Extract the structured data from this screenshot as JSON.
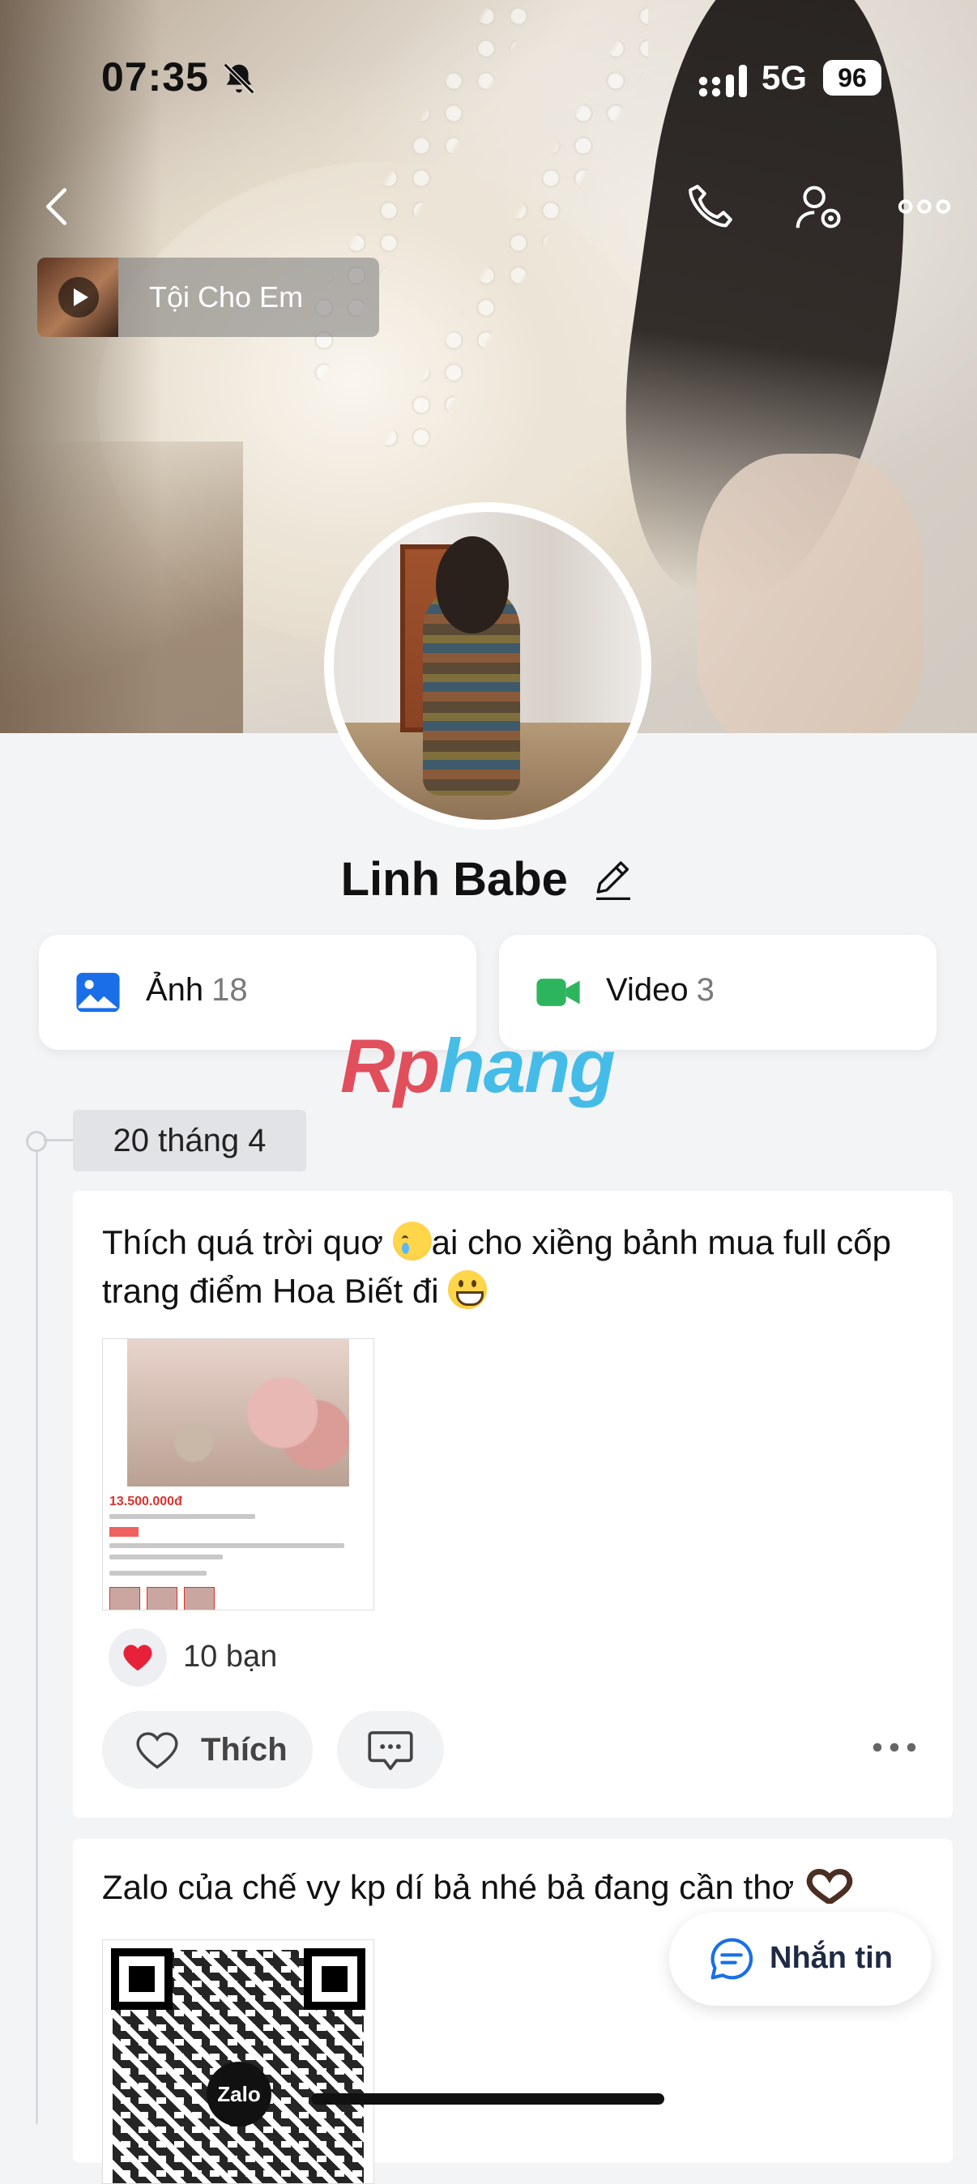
{
  "status_bar": {
    "time": "07:35",
    "network": "5G",
    "battery": "96"
  },
  "music": {
    "title": "Tội Cho Em"
  },
  "profile": {
    "name": "Linh Babe"
  },
  "media": {
    "photos": {
      "label": "Ảnh",
      "count": "18"
    },
    "videos": {
      "label": "Video",
      "count": "3"
    }
  },
  "watermark": {
    "part1": "Rp",
    "part2": "hang"
  },
  "timeline": {
    "date": "20 tháng 4"
  },
  "post1": {
    "text_a": "Thích quá trời quơ ",
    "text_b": "ai cho xiềng bảnh mua full cốp trang điểm Hoa Biết đi ",
    "image": {
      "price": "13.500.000đ"
    },
    "reactions": "10 bạn",
    "like_label": "Thích"
  },
  "post2": {
    "text": "Zalo của chế vy kp dí bả nhé bả đang cần thơ ",
    "qr_logo": "Zalo"
  },
  "message_button": {
    "label": "Nhắn tin"
  },
  "colors": {
    "accent": "#1a6fe8",
    "heart": "#e8213a",
    "video": "#2db55d"
  }
}
